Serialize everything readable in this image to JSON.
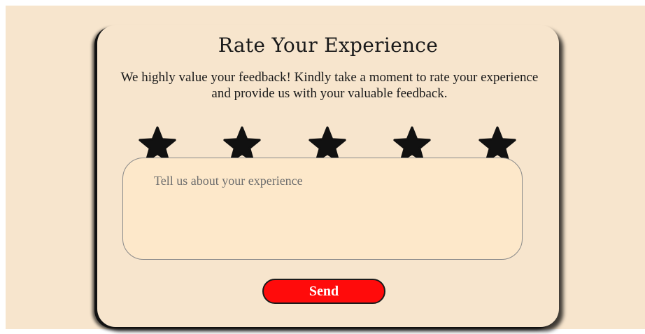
{
  "card": {
    "title": "Rate Your Experience",
    "subtitle": "We highly value your feedback! Kindly take a moment to rate your experience and provide us with your valuable feedback."
  },
  "rating": {
    "star_count": 5,
    "star_icon": "star-icon",
    "star_color": "#111111"
  },
  "feedback": {
    "placeholder": "Tell us about your experience",
    "value": ""
  },
  "send_button": {
    "label": "Send",
    "color": "#ff0b0b"
  },
  "colors": {
    "page_background": "#f7e5cd",
    "textarea_background": "#fde8ca"
  }
}
